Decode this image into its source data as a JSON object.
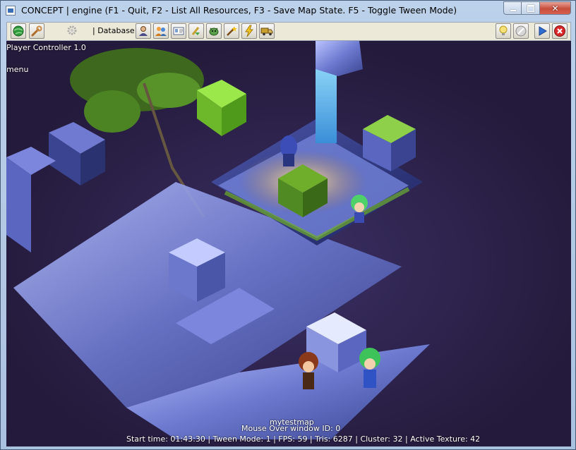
{
  "window": {
    "title": "CONCEPT | engine  (F1 - Quit, F2 - List All Resources, F3 - Save Map State. F5 - Toggle Tween Mode)",
    "controls": [
      "minimize",
      "maximize",
      "close"
    ]
  },
  "toolbar": {
    "left_buttons": [
      {
        "name": "globe-button",
        "icon": "globe-icon"
      },
      {
        "name": "tools-button",
        "icon": "wrench-icon"
      },
      {
        "name": "settings-button",
        "icon": "gear-icon"
      }
    ],
    "database_label": "| Database",
    "db_buttons": [
      {
        "name": "actors-button",
        "icon": "person-icon"
      },
      {
        "name": "classes-button",
        "icon": "people-icon"
      },
      {
        "name": "cards-button",
        "icon": "id-card-icon"
      },
      {
        "name": "items-button",
        "icon": "potion-icon"
      },
      {
        "name": "enemies-button",
        "icon": "monster-icon"
      },
      {
        "name": "skills-button",
        "icon": "wand-icon"
      },
      {
        "name": "effects-button",
        "icon": "lightning-icon"
      },
      {
        "name": "vehicles-button",
        "icon": "truck-icon"
      }
    ],
    "right_buttons": [
      {
        "name": "light-button",
        "icon": "bulb-icon"
      },
      {
        "name": "stop-button",
        "icon": "disc-icon"
      },
      {
        "name": "play-button",
        "icon": "play-icon"
      },
      {
        "name": "quit-button",
        "icon": "close-circle-icon"
      }
    ]
  },
  "hud": {
    "controller": "Player Controller 1.0",
    "menu": "menu",
    "map_name": "mytestmap",
    "mouse_over": "Mouse Over window ID: 0",
    "stats": "Start time: 01:43:30 | Tween Mode: 1 | FPS: 59 | Tris: 6287 | Cluster: 32 | Active Texture: 42"
  },
  "scene": {
    "description_colors": {
      "background": "#2b1f44",
      "stone": "#6f7fd4",
      "grass": "#6fae2a"
    }
  }
}
